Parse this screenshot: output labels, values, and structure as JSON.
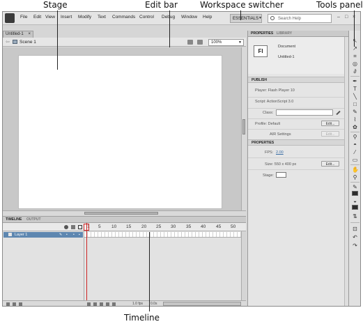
{
  "callouts": {
    "stage": "Stage",
    "edit_bar": "Edit bar",
    "workspace_switcher": "Workspace switcher",
    "tools_panel": "Tools panel",
    "timeline": "Timeline"
  },
  "menu": {
    "items": [
      "File",
      "Edit",
      "View",
      "Insert",
      "Modify",
      "Text",
      "Commands",
      "Control",
      "Debug",
      "Window",
      "Help"
    ]
  },
  "workspace": {
    "label": "ESSENTIALS"
  },
  "search": {
    "placeholder": "Search Help"
  },
  "window_controls": {
    "minimize": "–",
    "restore": "□",
    "close": "×"
  },
  "document": {
    "tab_label": "Untitled-1",
    "scene_label": "Scene 1",
    "zoom": "100%"
  },
  "timeline_panel": {
    "tabs": [
      "TIMELINE",
      "OUTPUT"
    ],
    "ruler": [
      "1",
      "5",
      "10",
      "15",
      "20",
      "25",
      "30",
      "35",
      "40",
      "45",
      "50"
    ],
    "layer_name": "Layer 1",
    "footer_fps": "1.0 fps",
    "footer_time": "0.0s"
  },
  "properties_panel": {
    "tabs": [
      "PROPERTIES",
      "LIBRARY"
    ],
    "doc_badge": "Fl",
    "doc_type": "Document",
    "doc_name": "Untitled-1",
    "publish": {
      "header": "PUBLISH",
      "player": "Player: Flash Player 10",
      "script": "Script: ActionScript 3.0",
      "class_label": "Class:",
      "profile": "Profile: Default",
      "air": "AIR Settings",
      "edit_label": "Edit..."
    },
    "properties": {
      "header": "PROPERTIES",
      "fps_label": "FPS:",
      "fps_value": "2.00",
      "size": "Size: 550 x 400 px",
      "stage_label": "Stage:"
    }
  },
  "tools": {
    "icons": [
      "selection-tool-icon",
      "subselection-tool-icon",
      "free-transform-tool-icon",
      "3d-rotation-tool-icon",
      "lasso-tool-icon",
      "pen-tool-icon",
      "text-tool-icon",
      "line-tool-icon",
      "rectangle-tool-icon",
      "pencil-tool-icon",
      "brush-tool-icon",
      "deco-tool-icon",
      "bone-tool-icon",
      "paint-bucket-tool-icon",
      "eyedropper-tool-icon",
      "eraser-tool-icon",
      "hand-tool-icon",
      "zoom-tool-icon"
    ]
  }
}
